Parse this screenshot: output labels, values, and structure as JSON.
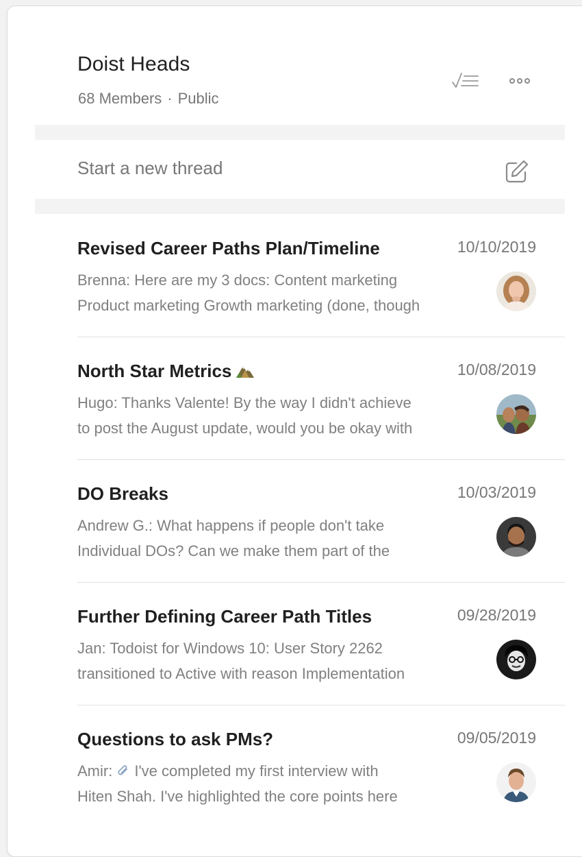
{
  "group": {
    "title": "Doist Heads",
    "members": "68 Members",
    "separator": "·",
    "visibility": "Public"
  },
  "icons": {
    "checklist": "checklist-icon",
    "more": "more-options-icon",
    "compose": "compose-icon",
    "mountain": "mountain-emoji-icon",
    "paperclip": "paperclip-icon"
  },
  "composer": {
    "placeholder": "Start a new thread"
  },
  "threads": [
    {
      "title": "Revised Career Paths Plan/Timeline",
      "date": "10/10/2019",
      "preview_line1": "Brenna: Here are my 3 docs: Content marketing",
      "preview_line2": "Product marketing Growth marketing (done, though"
    },
    {
      "title": "North Star Metrics",
      "date": "10/08/2019",
      "preview_line1": "Hugo: Thanks Valente! By the way I didn't achieve",
      "preview_line2": "to post the August update, would you be okay with"
    },
    {
      "title": "DO Breaks",
      "date": "10/03/2019",
      "preview_line1": "Andrew G.: What happens if people don't take",
      "preview_line2": "Individual DOs? Can we make them part of the"
    },
    {
      "title": "Further Defining Career Path Titles",
      "date": "09/28/2019",
      "preview_line1": "Jan: Todoist for Windows 10: User Story 2262",
      "preview_line2": "transitioned to Active with reason Implementation"
    },
    {
      "title": "Questions to ask PMs?",
      "date": "09/05/2019",
      "preview_author": "Amir:",
      "preview_line1_rest": "I've completed my first interview with",
      "preview_line2": "Hiten Shah. I've highlighted the core points here"
    }
  ],
  "colors": {
    "title": "#202020",
    "muted": "#777777",
    "preview": "#808080",
    "divider": "#e3e3e3",
    "band": "#f3f3f3"
  }
}
